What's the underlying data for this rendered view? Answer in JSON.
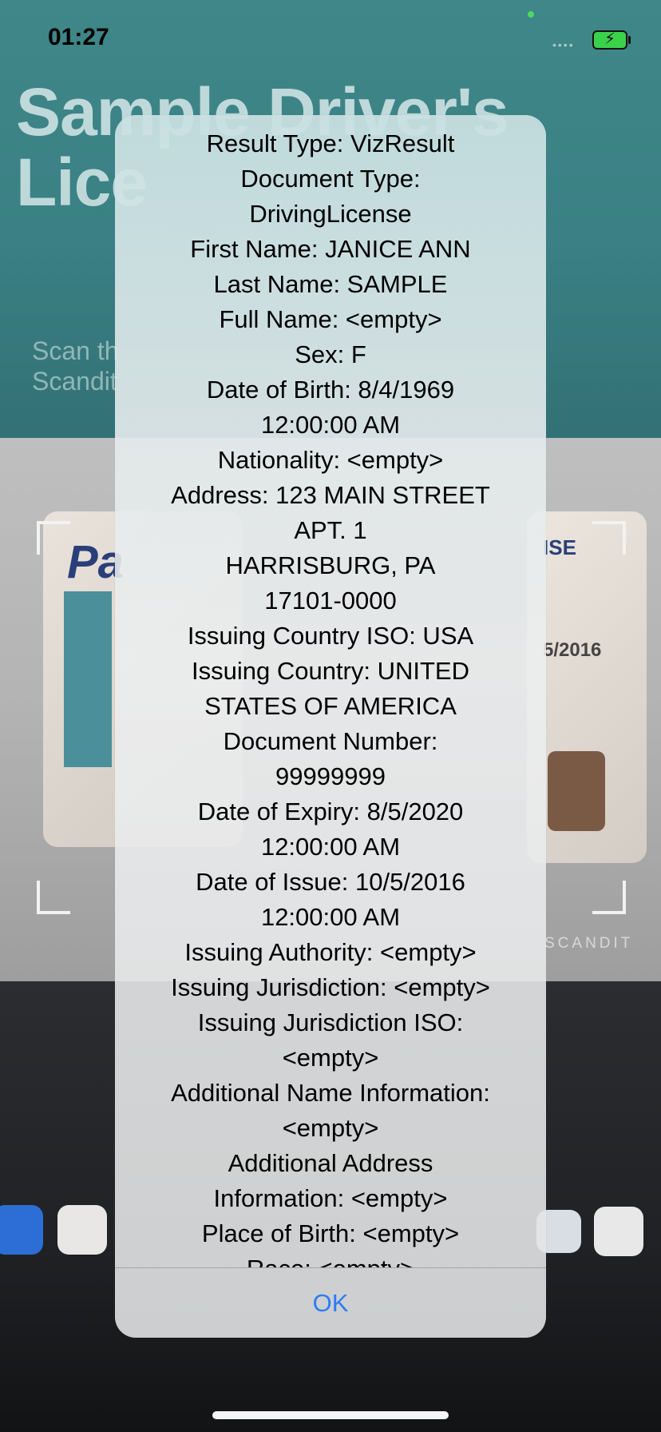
{
  "status_bar": {
    "time": "01:27",
    "battery_icon": "battery-charging-icon"
  },
  "background": {
    "headline": "Sample Driver's\nLice",
    "subtitle": "Scan th\nScandit",
    "card_left_badge": "Pa",
    "card_right_text": "ISE",
    "card_right_date": "5/2016",
    "watermark": "SCANDIT"
  },
  "alert": {
    "message_lines": [
      "Result Type: VizResult",
      "Document Type:",
      "DrivingLicense",
      "First Name: JANICE ANN",
      "Last Name: SAMPLE",
      "Full Name: <empty>",
      "Sex: F",
      "Date of Birth: 8/4/1969",
      "12:00:00 AM",
      "Nationality: <empty>",
      "Address: 123 MAIN STREET",
      "APT. 1",
      "HARRISBURG, PA",
      "17101-0000",
      "Issuing Country ISO: USA",
      "Issuing Country: UNITED",
      "STATES OF AMERICA",
      "Document Number:",
      "99999999",
      "Date of Expiry: 8/5/2020",
      "12:00:00 AM",
      "Date of Issue: 10/5/2016",
      "12:00:00 AM",
      "Issuing Authority: <empty>",
      "Issuing Jurisdiction: <empty>",
      "Issuing Jurisdiction ISO:",
      "<empty>",
      "Additional Name Information:",
      "<empty>",
      "Additional Address",
      "Information: <empty>",
      "Place of Birth: <empty>",
      "Race: <empty>"
    ],
    "ok_label": "OK",
    "ok_color": "#2c7bf6"
  }
}
